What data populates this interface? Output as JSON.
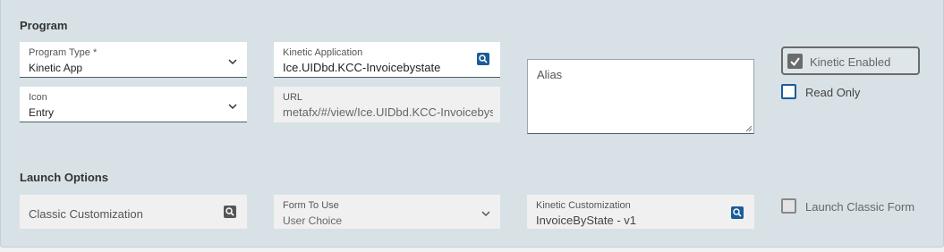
{
  "program": {
    "section_title": "Program",
    "program_type": {
      "label": "Program Type *",
      "value": "Kinetic App"
    },
    "icon": {
      "label": "Icon",
      "value": "Entry"
    },
    "kinetic_application": {
      "label": "Kinetic Application",
      "value": "Ice.UIDbd.KCC-Invoicebystate"
    },
    "url": {
      "label": "URL",
      "value": "metafx/#/view/Ice.UIDbd.KCC-Invoicebystate"
    },
    "alias": {
      "label": "Alias"
    },
    "kinetic_enabled": {
      "label": "Kinetic Enabled",
      "checked": true
    },
    "read_only": {
      "label": "Read Only",
      "checked": false
    }
  },
  "launch_options": {
    "section_title": "Launch Options",
    "classic_customization": {
      "label": "Classic Customization"
    },
    "form_to_use": {
      "label": "Form To Use",
      "value": "User Choice"
    },
    "kinetic_customization": {
      "label": "Kinetic Customization",
      "value": "InvoiceByState - v1"
    },
    "launch_classic_form": {
      "label": "Launch Classic Form",
      "checked": false
    }
  },
  "colors": {
    "panel_bg": "#d8e2e6",
    "accent_blue": "#1a5d9a",
    "checkbox_gray": "#6b6b6b"
  }
}
